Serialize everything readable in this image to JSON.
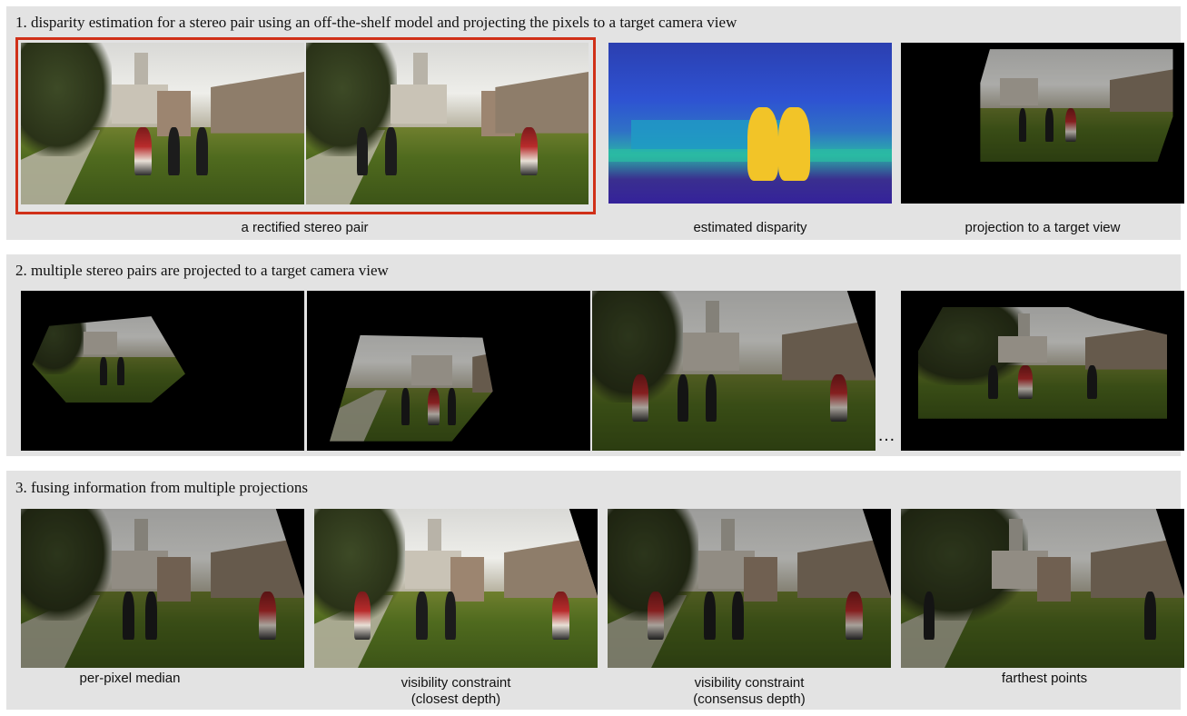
{
  "panels": [
    {
      "title": "1. disparity estimation for a stereo pair using an off-the-shelf model and projecting the pixels to a target camera view",
      "captions": [
        "a rectified stereo pair",
        "estimated disparity",
        "projection to a target view"
      ]
    },
    {
      "title": "2. multiple stereo pairs are projected to a target camera view",
      "ellipsis": "…"
    },
    {
      "title": "3. fusing information from multiple projections",
      "captions": [
        "per-pixel median",
        "visibility constraint\n(closest depth)",
        "visibility constraint\n(consensus depth)",
        "farthest points"
      ]
    }
  ],
  "colors": {
    "panel_bg": "#e3e3e3",
    "highlight_box": "#d03018",
    "disparity_near": "#f2c428",
    "disparity_far": "#2b3fb0"
  }
}
